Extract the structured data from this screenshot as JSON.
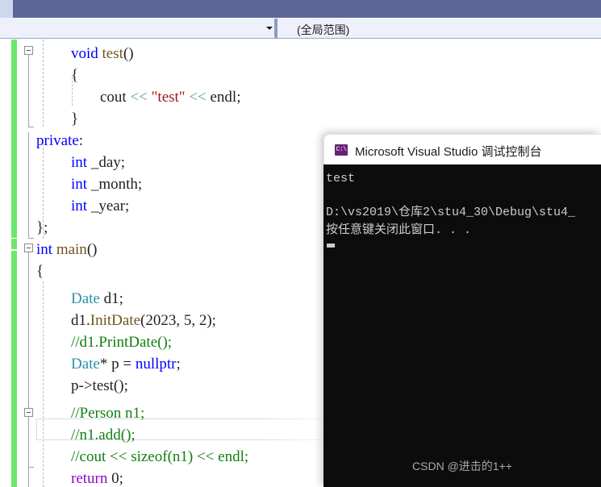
{
  "window": {
    "title_bar_color": "#5b6796",
    "nav_bar_color": "#eef1fb"
  },
  "navbar": {
    "member_combo_value": "",
    "scope_combo_value": "(全局范围)",
    "dropdown_icon": "chevron-down-icon"
  },
  "editor": {
    "current_line_index": 17,
    "change_bar_color": "#6ce86c",
    "lines": [
      {
        "indent": 0,
        "text": ""
      },
      {
        "indent": 0,
        "text": ""
      },
      {
        "indent": 0,
        "text": ""
      },
      {
        "indent": 0,
        "text": ""
      },
      {
        "indent": 0,
        "text": ""
      },
      {
        "indent": 0,
        "text": ""
      },
      {
        "indent": 0,
        "text": ""
      },
      {
        "indent": 0,
        "text": ""
      },
      {
        "indent": 0,
        "text": ""
      },
      {
        "indent": 0,
        "text": ""
      },
      {
        "indent": 0,
        "text": ""
      },
      {
        "indent": 0,
        "text": ""
      },
      {
        "indent": 0,
        "text": ""
      },
      {
        "indent": 0,
        "text": ""
      },
      {
        "indent": 0,
        "text": ""
      },
      {
        "indent": 0,
        "text": ""
      },
      {
        "indent": 0,
        "text": ""
      },
      {
        "indent": 0,
        "text": ""
      },
      {
        "indent": 0,
        "text": ""
      },
      {
        "indent": 0,
        "text": ""
      },
      {
        "indent": 0,
        "text": ""
      }
    ],
    "code_text": {
      "l1_void": "void",
      "l1_test": "test",
      "l1_parens": "()",
      "l2_brace": "{",
      "l3_cout": "cout",
      "l3_shift1": "<<",
      "l3_str": "\"test\"",
      "l3_shift2": "<<",
      "l3_endl": "endl;",
      "l4_brace": "}",
      "l5_private": "private",
      "l5_colon": ":",
      "l6_int": "int",
      "l6_name": "_day;",
      "l7_int": "int",
      "l7_name": "_month;",
      "l8_int": "int",
      "l8_name": "_year;",
      "l9_close": "};",
      "l10_int": "int",
      "l10_main": "main",
      "l10_parens": "()",
      "l11_brace": "{",
      "l12_cls": "Date",
      "l12_var": "d1;",
      "l13_obj": "d1.",
      "l13_fn": "InitDate",
      "l13_args": "(2023, 5, 2);",
      "l14_comment": "//d1.PrintDate();",
      "l15_cls": "Date",
      "l15_star": "* p = ",
      "l15_null": "nullptr",
      "l15_semi": ";",
      "l16_call": "p->test();",
      "l17_comment": "//Person n1;",
      "l18_comment": "//n1.add();",
      "l19_comment": "//cout << sizeof(n1) << endl;",
      "l20_return": "return",
      "l20_zero": " 0;"
    }
  },
  "console": {
    "icon_name": "console-app-icon",
    "icon_glyph": "C:\\",
    "title": "Microsoft Visual Studio 调试控制台",
    "output_lines": [
      "test",
      "",
      "D:\\vs2019\\仓库2\\stu4_30\\Debug\\stu4_",
      "按任意键关闭此窗口. . ."
    ],
    "watermark": "CSDN @进击的1++"
  }
}
